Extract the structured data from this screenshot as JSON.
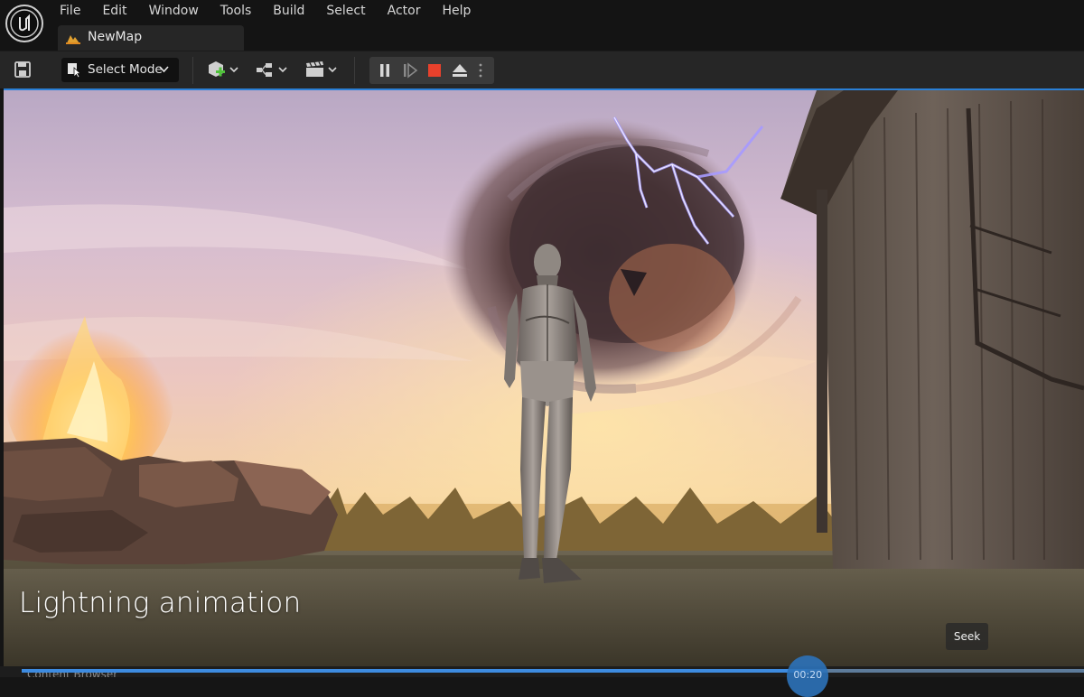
{
  "menu": {
    "items": [
      "File",
      "Edit",
      "Window",
      "Tools",
      "Build",
      "Select",
      "Actor",
      "Help"
    ]
  },
  "document_tab": {
    "label": "NewMap",
    "icon": "level-map-icon"
  },
  "toolbar": {
    "save_icon": "save-icon",
    "select_mode": {
      "label": "Select Mode",
      "icon": "select-arrow-icon"
    },
    "dropdowns": [
      "quick-add-icon",
      "blueprint-icon",
      "cinematics-clapper-icon"
    ],
    "playback": {
      "pause_icon": "pause-icon",
      "advance_frame_icon": "frame-advance-icon",
      "stop_icon": "stop-icon",
      "eject_icon": "eject-icon",
      "more_icon": "vertical-dots-icon",
      "stop_color": "#e8412c"
    }
  },
  "viewport": {
    "caption": "Lightning animation",
    "tooltip": "Seek",
    "accent_color": "#2a7fd6"
  },
  "seekbar": {
    "progress": 0.74,
    "time_label": "00:20",
    "bottom_tab_label": "Content Browser"
  }
}
